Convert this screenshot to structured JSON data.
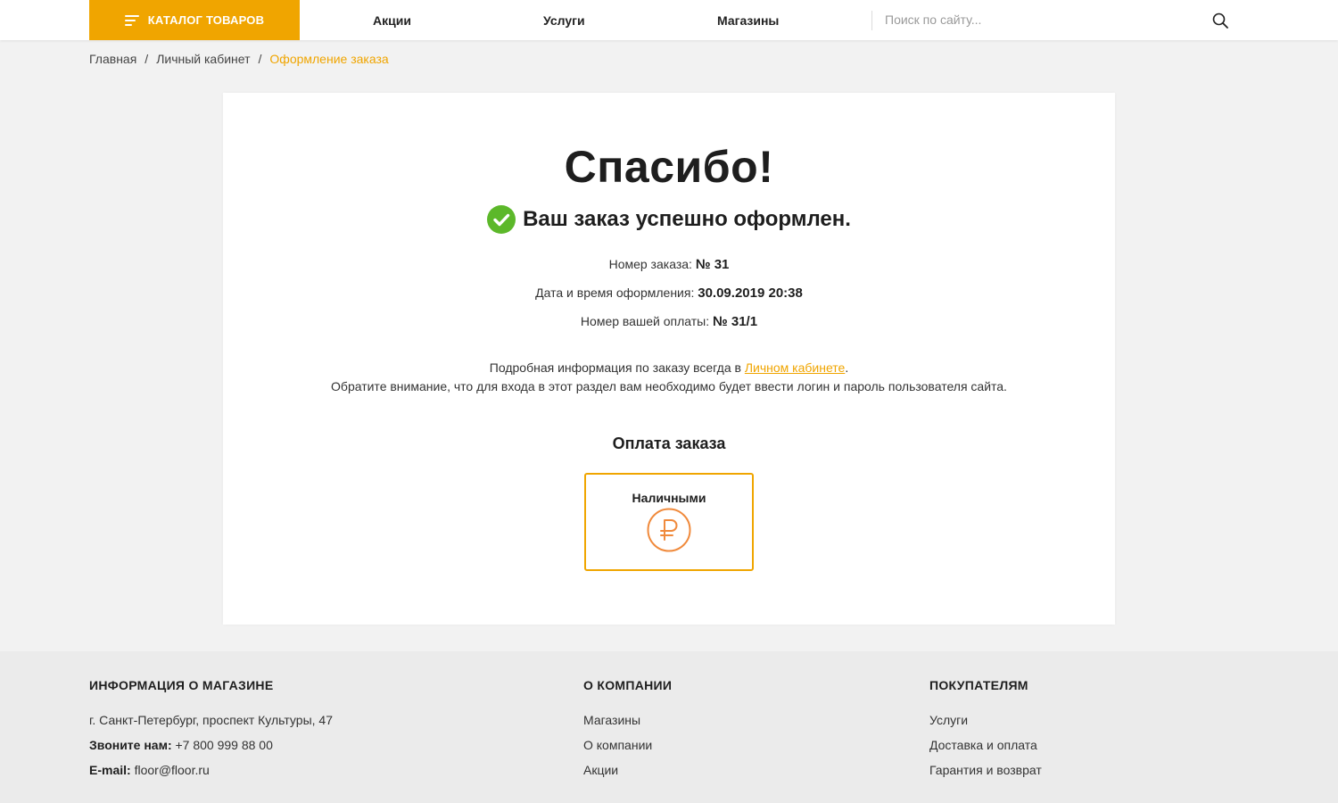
{
  "header": {
    "catalog_label": "КАТАЛОГ ТОВАРОВ",
    "nav": [
      "Акции",
      "Услуги",
      "Магазины"
    ],
    "search_placeholder": "Поиск по сайту..."
  },
  "breadcrumb": {
    "items": [
      "Главная",
      "Личный кабинет"
    ],
    "current": "Оформление заказа",
    "separator": "/"
  },
  "order": {
    "title": "Спасибо!",
    "success_text": "Ваш заказ успешно оформлен.",
    "number_label": "Номер заказа:",
    "number_value": "№ 31",
    "date_label": "Дата и время оформления:",
    "date_value": "30.09.2019 20:38",
    "payment_number_label": "Номер вашей оплаты:",
    "payment_number_value": "№ 31/1",
    "note_prefix": "Подробная информация по заказу всегда в",
    "note_link": "Личном кабинете",
    "note_suffix": ".",
    "note_line2": "Обратите внимание, что для входа в этот раздел вам необходимо будет ввести логин и пароль пользователя сайта."
  },
  "payment": {
    "title": "Оплата заказа",
    "method_label": "Наличными",
    "method_icon": "ruble-icon"
  },
  "footer": {
    "store": {
      "title": "ИНФОРМАЦИЯ О МАГАЗИНЕ",
      "address": "г. Санкт-Петербург, проспект Культуры, 47",
      "phone_label": "Звоните нам:",
      "phone": "+7 800 999 88 00",
      "email_label": "E-mail:",
      "email": "floor@floor.ru"
    },
    "company": {
      "title": "О КОМПАНИИ",
      "items": [
        "Магазины",
        "О компании",
        "Акции"
      ]
    },
    "buyers": {
      "title": "ПОКУПАТЕЛЯМ",
      "items": [
        "Услуги",
        "Доставка и оплата",
        "Гарантия и возврат"
      ]
    }
  },
  "colors": {
    "accent": "#f0a500",
    "success": "#5cb82a",
    "ruble": "#f08a3c"
  }
}
